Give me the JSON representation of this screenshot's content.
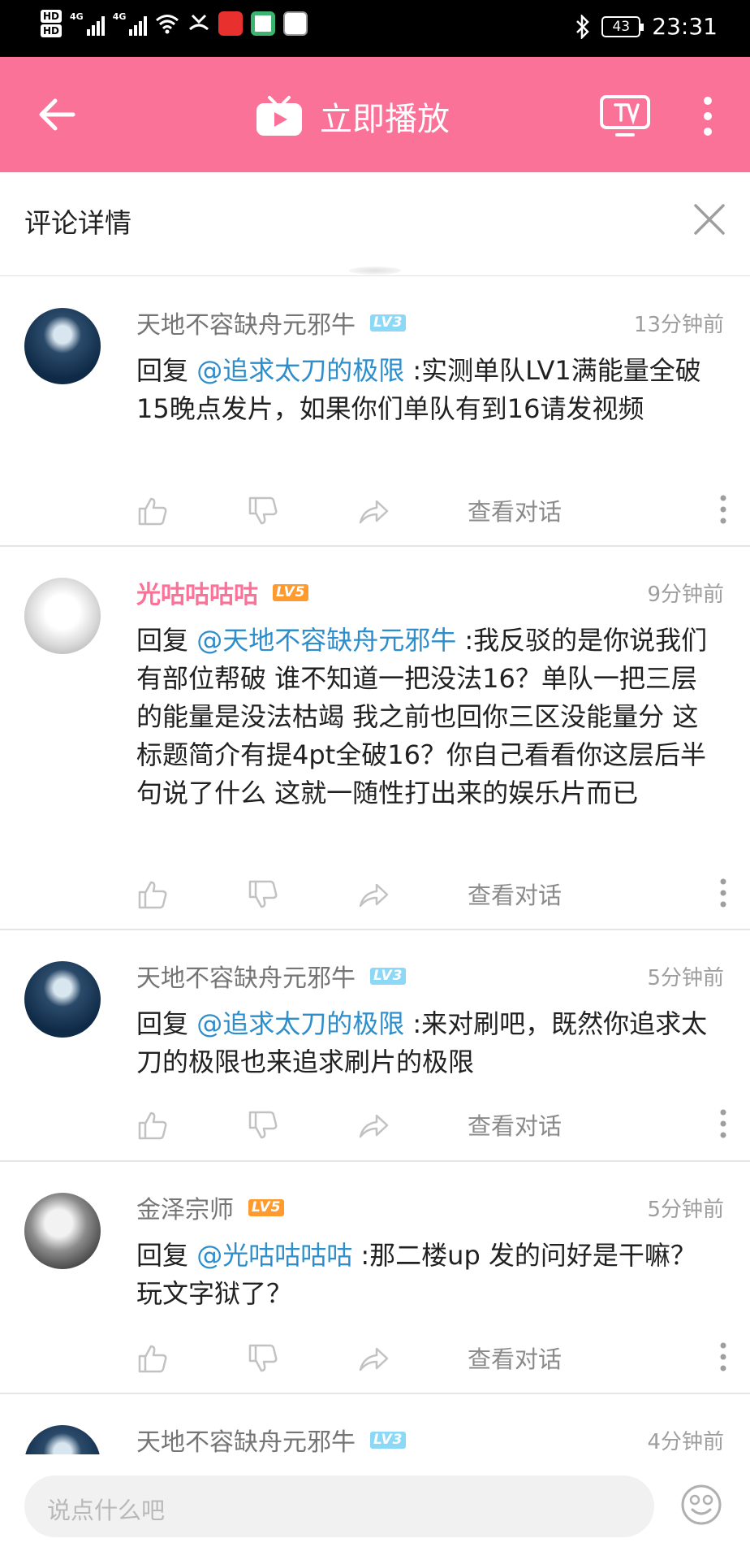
{
  "status_bar": {
    "hd1": "HD",
    "hd2": "HD",
    "net1": "4G",
    "net2": "4G",
    "battery": "43",
    "time": "23:31"
  },
  "header": {
    "title": "立即播放"
  },
  "section": {
    "title": "评论详情"
  },
  "comments": [
    {
      "user": "天地不容缺舟元邪牛",
      "level": "LV3",
      "time": "13分钟前",
      "reply_prefix": "回复 ",
      "mention": "@追求太刀的极限",
      "text": " :实测单队LV1满能量全破15晚点发片，如果你们单队有到16请发视频",
      "view_conversation": "查看对话"
    },
    {
      "user": "光咕咕咕咕",
      "level": "LV5",
      "time": "9分钟前",
      "reply_prefix": "回复 ",
      "mention": "@天地不容缺舟元邪牛",
      "text": " :我反驳的是你说我们有部位帮破 谁不知道一把没法16？单队一把三层的能量是没法枯竭 我之前也回你三区没能量分 这标题简介有提4pt全破16？你自己看看你这层后半句说了什么 这就一随性打出来的娱乐片而已",
      "view_conversation": "查看对话"
    },
    {
      "user": "天地不容缺舟元邪牛",
      "level": "LV3",
      "time": "5分钟前",
      "reply_prefix": "回复 ",
      "mention": "@追求太刀的极限",
      "text": " :来对刷吧，既然你追求太刀的极限也来追求刷片的极限",
      "view_conversation": "查看对话"
    },
    {
      "user": "金泽宗师",
      "level": "LV5",
      "time": "5分钟前",
      "reply_prefix": "回复 ",
      "mention": "@光咕咕咕咕",
      "text": " :那二楼up 发的问好是干嘛？玩文字狱了？",
      "view_conversation": "查看对话"
    },
    {
      "user": "天地不容缺舟元邪牛",
      "level": "LV3",
      "time": "4分钟前"
    }
  ],
  "composer": {
    "placeholder": "说点什么吧"
  },
  "colors": {
    "brand_pink": "#fb7299",
    "mention_blue": "#2d8ecb",
    "lv3": "#8bd8f7",
    "lv5": "#ff9a2e"
  }
}
